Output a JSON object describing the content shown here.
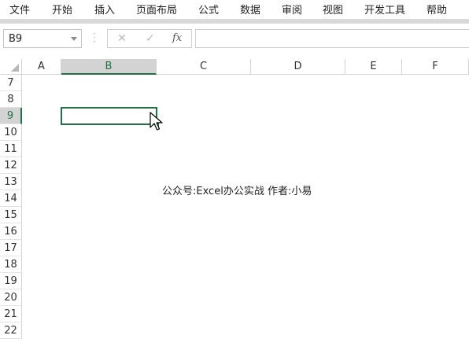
{
  "ribbon": {
    "tabs": [
      "文件",
      "开始",
      "插入",
      "页面布局",
      "公式",
      "数据",
      "审阅",
      "视图",
      "开发工具",
      "帮助"
    ]
  },
  "formula_bar": {
    "name_box": "B9",
    "cancel_icon": "✕",
    "enter_icon": "✓",
    "fx_label": "fx",
    "formula": ""
  },
  "columns": [
    "A",
    "B",
    "C",
    "D",
    "E",
    "F"
  ],
  "selected_column": "B",
  "rows": [
    "7",
    "8",
    "9",
    "10",
    "11",
    "12",
    "13",
    "14",
    "15",
    "16",
    "17",
    "18",
    "19",
    "20",
    "21",
    "22"
  ],
  "selected_row": "9",
  "selected_cell": "B9",
  "cell_text": {
    "C13": "公众号:Excel办公实战  作者:小易"
  },
  "colors": {
    "accent": "#217346",
    "header_selected_bg": "#d3d3d3",
    "gridline": "#d4d4d4"
  }
}
